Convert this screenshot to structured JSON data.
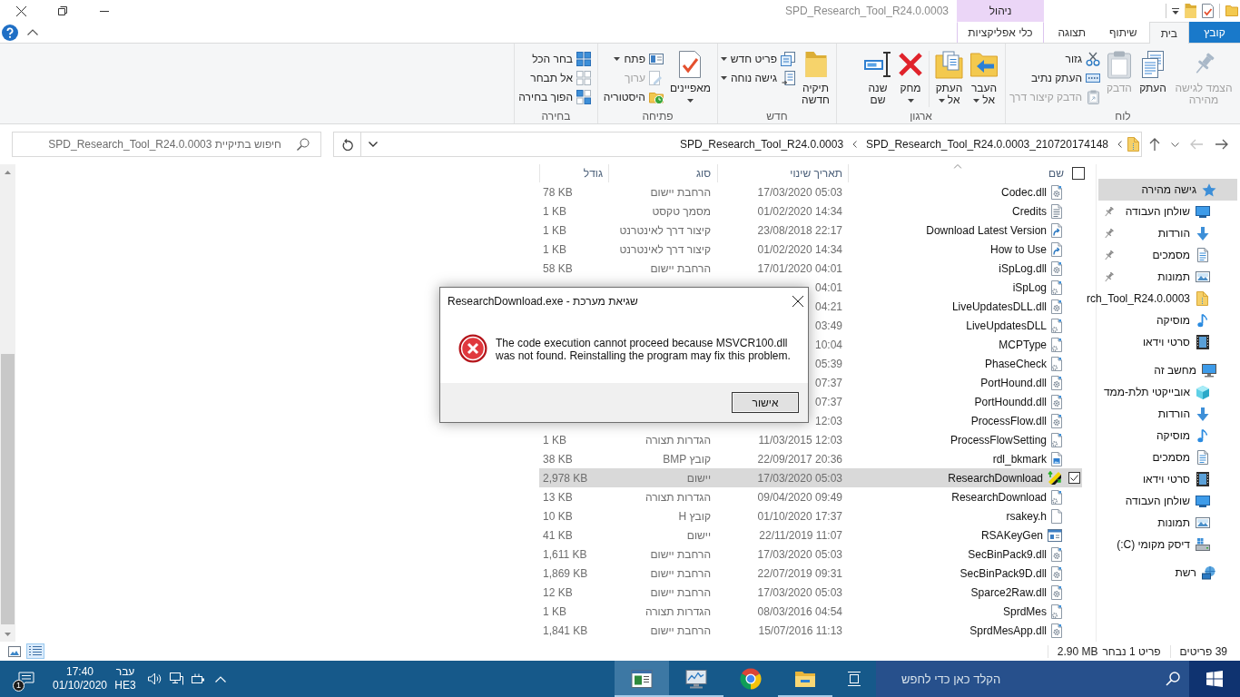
{
  "window": {
    "title": "SPD_Research_Tool_R24.0.0003",
    "context_header": "ניהול"
  },
  "ribbon_tabs": [
    {
      "label": "קובץ",
      "kind": "menu",
      "selected": false
    },
    {
      "label": "בית",
      "kind": "tab",
      "selected": true
    },
    {
      "label": "שיתוף",
      "kind": "tab",
      "selected": false
    },
    {
      "label": "תצוגה",
      "kind": "tab",
      "selected": false
    },
    {
      "label": "כלי אפליקציות",
      "kind": "context",
      "selected": false
    }
  ],
  "ribbon_groups": [
    {
      "label": "לוח",
      "buttons": [
        {
          "label": "הצמד לגישה מהירה",
          "kind": "large",
          "disabled": true,
          "dropdown": false
        },
        {
          "label": "העתק",
          "kind": "large",
          "disabled": false,
          "dropdown": false
        },
        {
          "label": "הדבק",
          "kind": "large",
          "disabled": true,
          "dropdown": false
        },
        {
          "label": "גזור",
          "kind": "small",
          "disabled": false,
          "dropdown": false
        },
        {
          "label": "העתק נתיב",
          "kind": "small",
          "disabled": false,
          "dropdown": false
        },
        {
          "label": "הדבק קיצור דרך",
          "kind": "small",
          "disabled": true,
          "dropdown": false
        }
      ]
    },
    {
      "label": "ארגון",
      "buttons": [
        {
          "label": "העבר אל",
          "kind": "large",
          "disabled": false,
          "dropdown": true
        },
        {
          "label": "העתק אל",
          "kind": "large",
          "disabled": false,
          "dropdown": true
        },
        {
          "label": "מחק",
          "kind": "large",
          "disabled": false,
          "dropdown": true
        },
        {
          "label": "שנה שם",
          "kind": "large",
          "disabled": false,
          "dropdown": false
        }
      ]
    },
    {
      "label": "חדש",
      "buttons": [
        {
          "label": "תיקיה חדשה",
          "kind": "large",
          "disabled": false,
          "dropdown": false
        },
        {
          "label": "פריט חדש",
          "kind": "small",
          "disabled": false,
          "dropdown": true
        },
        {
          "label": "גישה נוחה",
          "kind": "small",
          "disabled": false,
          "dropdown": true
        }
      ]
    },
    {
      "label": "פתיחה",
      "buttons": [
        {
          "label": "מאפיינים",
          "kind": "large",
          "disabled": false,
          "dropdown": true
        },
        {
          "label": "פתח",
          "kind": "small",
          "disabled": false,
          "dropdown": true
        },
        {
          "label": "ערוך",
          "kind": "small",
          "disabled": true,
          "dropdown": false
        },
        {
          "label": "היסטוריה",
          "kind": "small",
          "disabled": false,
          "dropdown": false
        }
      ]
    },
    {
      "label": "בחירה",
      "buttons": [
        {
          "label": "בחר הכל",
          "kind": "small",
          "disabled": false,
          "dropdown": false
        },
        {
          "label": "אל תבחר",
          "kind": "small",
          "disabled": false,
          "dropdown": false
        },
        {
          "label": "הפוך בחירה",
          "kind": "small",
          "disabled": false,
          "dropdown": false
        }
      ]
    }
  ],
  "nav_buttons": [
    {
      "kind": "back",
      "disabled": false
    },
    {
      "kind": "forward",
      "disabled": true
    },
    {
      "kind": "recent",
      "disabled": false
    },
    {
      "kind": "up",
      "disabled": false
    }
  ],
  "address_bar": {
    "crumbs": [
      "SPD_Research_Tool_R24.0.0003_210720174148",
      "SPD_Research_Tool_R24.0.0003"
    ]
  },
  "search": {
    "placeholder": "חיפוש בתיקיית SPD_Research_Tool_R24.0.0003"
  },
  "navigation_pane": {
    "items": [
      {
        "label": "גישה מהירה",
        "kind": "star",
        "selected": true,
        "children": [
          {
            "label": "שולחן העבודה",
            "kind": "desktop",
            "selected": false,
            "pinned": true
          },
          {
            "label": "הורדות",
            "kind": "downloads",
            "selected": false,
            "pinned": true
          },
          {
            "label": "מסמכים",
            "kind": "documents",
            "selected": false,
            "pinned": true
          },
          {
            "label": "תמונות",
            "kind": "pictures",
            "selected": false,
            "pinned": true
          },
          {
            "label": "rch_Tool_R24.0.0003",
            "kind": "folder",
            "selected": false,
            "pinned": false
          },
          {
            "label": "מוסיקה",
            "kind": "music",
            "selected": false,
            "pinned": false
          },
          {
            "label": "סרטי וידאו",
            "kind": "videos",
            "selected": false,
            "pinned": false
          }
        ]
      },
      {
        "label": "מחשב זה",
        "kind": "computer",
        "selected": false,
        "children": [
          {
            "label": "אובייקטי תלת-ממד",
            "kind": "objects",
            "selected": false
          },
          {
            "label": "הורדות",
            "kind": "downloads",
            "selected": false
          },
          {
            "label": "מוסיקה",
            "kind": "music",
            "selected": false
          },
          {
            "label": "מסמכים",
            "kind": "documents",
            "selected": false
          },
          {
            "label": "סרטי וידאו",
            "kind": "videos",
            "selected": false
          },
          {
            "label": "שולחן העבודה",
            "kind": "desktop",
            "selected": false
          },
          {
            "label": "תמונות",
            "kind": "pictures",
            "selected": false
          },
          {
            "label": "דיסק מקומי (C:)",
            "kind": "drive",
            "selected": false
          }
        ]
      },
      {
        "label": "רשת",
        "kind": "network",
        "selected": false
      }
    ]
  },
  "file_list": {
    "select_all": {
      "checked": false
    },
    "columns": [
      {
        "label": "שם",
        "sorted": true
      },
      {
        "label": "תאריך שינוי",
        "sorted": false
      },
      {
        "label": "סוג",
        "sorted": false
      },
      {
        "label": "גודל",
        "sorted": false
      }
    ],
    "rows": [
      {
        "name": "Codec.dll",
        "date": "17/03/2020 05:03",
        "type": "הרחבת יישום",
        "size": "78 KB",
        "kind": "dll",
        "selected": false
      },
      {
        "name": "Credits",
        "date": "01/02/2020 14:34",
        "type": "מסמך טקסט",
        "size": "1 KB",
        "kind": "text",
        "selected": false
      },
      {
        "name": "Download Latest Version",
        "date": "23/08/2018 22:17",
        "type": "קיצור דרך לאינטרנט",
        "size": "1 KB",
        "kind": "shortcut",
        "selected": false
      },
      {
        "name": "How to Use",
        "date": "01/02/2020 14:34",
        "type": "קיצור דרך לאינטרנט",
        "size": "1 KB",
        "kind": "shortcut",
        "selected": false
      },
      {
        "name": "iSpLog.dll",
        "date": "17/01/2020 04:01",
        "type": "הרחבת יישום",
        "size": "58 KB",
        "kind": "dll",
        "selected": false
      },
      {
        "name": "iSpLog",
        "date": "04:01",
        "kind": "config",
        "selected": false
      },
      {
        "name": "LiveUpdatesDLL.dll",
        "date": "04:21",
        "kind": "dll",
        "selected": false
      },
      {
        "name": "LiveUpdatesDLL",
        "date": "03:49",
        "kind": "config",
        "selected": false
      },
      {
        "name": "MCPType",
        "date": "10:04",
        "kind": "config",
        "selected": false
      },
      {
        "name": "PhaseCheck",
        "date": "05:39",
        "kind": "config",
        "selected": false
      },
      {
        "name": "PortHound.dll",
        "date": "07:37",
        "kind": "dll",
        "selected": false
      },
      {
        "name": "PortHoundd.dll",
        "date": "07:37",
        "kind": "dll",
        "selected": false
      },
      {
        "name": "ProcessFlow.dll",
        "date": "12:03",
        "kind": "dll",
        "selected": false
      },
      {
        "name": "ProcessFlowSetting",
        "date": "11/03/2015 12:03",
        "type": "הגדרות תצורה",
        "size": "1 KB",
        "kind": "config",
        "selected": false
      },
      {
        "name": "rdl_bkmark",
        "date": "22/09/2017 20:36",
        "type": "קובץ BMP",
        "size": "38 KB",
        "kind": "image",
        "selected": false
      },
      {
        "name": "ResearchDownload",
        "date": "17/03/2020 05:03",
        "type": "יישום",
        "size": "2,978 KB",
        "kind": "program",
        "selected": true
      },
      {
        "name": "ResearchDownload",
        "date": "09/04/2020 09:49",
        "type": "הגדרות תצורה",
        "size": "13 KB",
        "kind": "config",
        "selected": false
      },
      {
        "name": "rsakey.h",
        "date": "01/10/2020 17:37",
        "type": "קובץ H",
        "size": "10 KB",
        "kind": "header",
        "selected": false
      },
      {
        "name": "RSAKeyGen",
        "date": "22/11/2019 11:07",
        "type": "יישום",
        "size": "41 KB",
        "kind": "app",
        "selected": false
      },
      {
        "name": "SecBinPack9.dll",
        "date": "17/03/2020 05:03",
        "type": "הרחבת יישום",
        "size": "1,611 KB",
        "kind": "dll",
        "selected": false
      },
      {
        "name": "SecBinPack9D.dll",
        "date": "22/07/2019 09:31",
        "type": "הרחבת יישום",
        "size": "1,869 KB",
        "kind": "dll",
        "selected": false
      },
      {
        "name": "Sparce2Raw.dll",
        "date": "17/03/2020 05:03",
        "type": "הרחבת יישום",
        "size": "12 KB",
        "kind": "dll",
        "selected": false
      },
      {
        "name": "SprdMes",
        "date": "08/03/2016 04:54",
        "type": "הגדרות תצורה",
        "size": "1 KB",
        "kind": "config",
        "selected": false
      },
      {
        "name": "SprdMesApp.dll",
        "date": "15/07/2016 11:13",
        "type": "הרחבת יישום",
        "size": "1,841 KB",
        "kind": "dll",
        "selected": false
      }
    ]
  },
  "status_bar": {
    "item_count": "39 פריטים",
    "selection": "פריט 1 נבחר",
    "selection_size": "2.90 MB",
    "views": [
      {
        "kind": "details",
        "selected": true
      },
      {
        "kind": "icons",
        "selected": false
      }
    ]
  },
  "taskbar": {
    "search": {
      "placeholder": "הקלד כאן כדי לחפש"
    },
    "apps": [
      {
        "kind": "explorer",
        "running": true,
        "active": false
      },
      {
        "kind": "browser",
        "running": false,
        "active": false
      },
      {
        "kind": "monitor",
        "running": true,
        "active": false
      },
      {
        "kind": "window",
        "running": true,
        "active": true
      }
    ],
    "language": {
      "label": "עבר",
      "code": "HE3"
    },
    "clock": {
      "time": "17:40",
      "date": "01/10/2020"
    },
    "notification_count": "1"
  },
  "dialog": {
    "title": "ResearchDownload.exe - שגיאת מערכת",
    "message": "The code execution cannot proceed because MSVCR100.dll was not found. Reinstalling the program may fix this problem.",
    "buttons": [
      "אישור"
    ]
  }
}
